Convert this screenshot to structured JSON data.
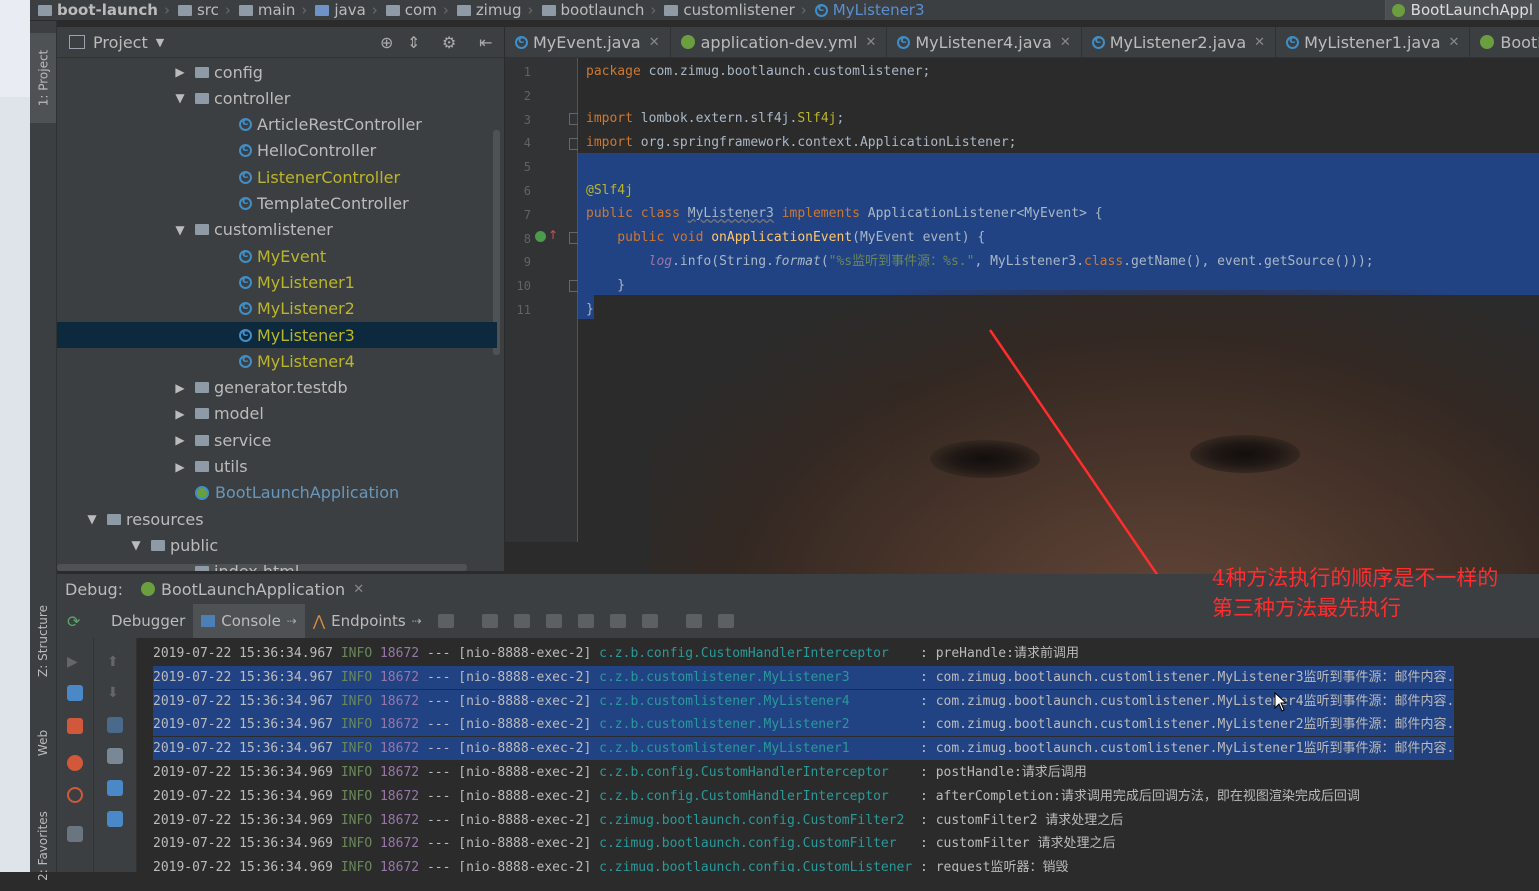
{
  "breadcrumb": {
    "items": [
      "boot-launch",
      "src",
      "main",
      "java",
      "com",
      "zimug",
      "bootlaunch",
      "customlistener",
      "MyListener3"
    ],
    "run_config": "BootLaunchAppl"
  },
  "sidebar": {
    "project_tab": "1: Project",
    "structure_tab": "Z: Structure",
    "web_tab": "Web",
    "favorites_tab": "2: Favorites"
  },
  "project": {
    "title": "Project",
    "tree": [
      {
        "label": "config",
        "type": "folder",
        "arrow": "▶",
        "indent": 0,
        "style": ""
      },
      {
        "label": "controller",
        "type": "folder",
        "arrow": "▼",
        "indent": 0,
        "style": ""
      },
      {
        "label": "ArticleRestController",
        "type": "class",
        "arrow": "",
        "indent": 1,
        "style": ""
      },
      {
        "label": "HelloController",
        "type": "class",
        "arrow": "",
        "indent": 1,
        "style": ""
      },
      {
        "label": "ListenerController",
        "type": "class",
        "arrow": "",
        "indent": 1,
        "style": "yellow"
      },
      {
        "label": "TemplateController",
        "type": "class",
        "arrow": "",
        "indent": 1,
        "style": ""
      },
      {
        "label": "customlistener",
        "type": "folder",
        "arrow": "▼",
        "indent": 0,
        "style": ""
      },
      {
        "label": "MyEvent",
        "type": "class",
        "arrow": "",
        "indent": 1,
        "style": "yellow"
      },
      {
        "label": "MyListener1",
        "type": "class",
        "arrow": "",
        "indent": 1,
        "style": "yellow"
      },
      {
        "label": "MyListener2",
        "type": "class",
        "arrow": "",
        "indent": 1,
        "style": "yellow"
      },
      {
        "label": "MyListener3",
        "type": "class",
        "arrow": "",
        "indent": 1,
        "style": "yellow",
        "selected": true
      },
      {
        "label": "MyListener4",
        "type": "class",
        "arrow": "",
        "indent": 1,
        "style": "yellow"
      },
      {
        "label": "generator.testdb",
        "type": "folder",
        "arrow": "▶",
        "indent": 0,
        "style": ""
      },
      {
        "label": "model",
        "type": "folder",
        "arrow": "▶",
        "indent": 0,
        "style": ""
      },
      {
        "label": "service",
        "type": "folder",
        "arrow": "▶",
        "indent": 0,
        "style": ""
      },
      {
        "label": "utils",
        "type": "folder",
        "arrow": "▶",
        "indent": 0,
        "style": ""
      },
      {
        "label": "BootLaunchApplication",
        "type": "spring",
        "arrow": "",
        "indent": 0,
        "style": "changed"
      },
      {
        "label": "resources",
        "type": "folder",
        "arrow": "▼",
        "indent": -2,
        "style": ""
      },
      {
        "label": "public",
        "type": "folder",
        "arrow": "▼",
        "indent": -1,
        "style": ""
      },
      {
        "label": "index.html",
        "type": "file",
        "arrow": "",
        "indent": 0,
        "style": ""
      }
    ]
  },
  "tabs": [
    {
      "label": "MyEvent.java",
      "icon": "class-icon"
    },
    {
      "label": "application-dev.yml",
      "icon": "spring-icon"
    },
    {
      "label": "MyListener4.java",
      "icon": "class-icon"
    },
    {
      "label": "MyListener2.java",
      "icon": "class-icon"
    },
    {
      "label": "MyListener1.java",
      "icon": "class-icon"
    },
    {
      "label": "BootLaunch",
      "icon": "spring-icon"
    }
  ],
  "editor": {
    "line_numbers": [
      "1",
      "2",
      "3",
      "4",
      "5",
      "6",
      "7",
      "8",
      "9",
      "10",
      "11"
    ],
    "code": {
      "l1_kw": "package",
      "l1_rest": " com.zimug.bootlaunch.customlistener;",
      "l3_kw": "import",
      "l3_rest": " lombok.extern.slf4j.",
      "l3_ann": "Slf4j",
      "l3_end": ";",
      "l4_kw": "import",
      "l4_rest": " org.springframework.context.ApplicationListener;",
      "l6_ann": "@Slf4j",
      "l7_kw1": "public class ",
      "l7_name": "MyListener3",
      "l7_kw2": " implements ",
      "l7_rest": "ApplicationListener<MyEvent> {",
      "l8_kw": "    public void ",
      "l8_fn": "onApplicationEvent",
      "l8_rest": "(MyEvent event) {",
      "l9_indent": "        ",
      "l9_log": "log",
      "l9_a": ".info(String.",
      "l9_fmt": "format",
      "l9_b": "(",
      "l9_str": "\"%s监听到事件源：%s.\"",
      "l9_c": ", MyListener3.",
      "l9_kw": "class",
      "l9_d": ".getName(), event.getSource()));",
      "l10": "    }",
      "l11": "}"
    }
  },
  "debug": {
    "label": "Debug:",
    "session": "BootLaunchApplication",
    "tabs": [
      "Debugger",
      "Console",
      "Endpoints"
    ]
  },
  "console": {
    "rows": [
      {
        "ts": "2019-07-22 15:36:34.967",
        "lvl": "INFO",
        "pid": "18672",
        "thread": " --- [nio-8888-exec-2] ",
        "logger": "c.z.b.config.CustomHandlerInterceptor   ",
        "msg": " : preHandle:请求前调用",
        "sel": false
      },
      {
        "ts": "2019-07-22 15:36:34.967",
        "lvl": "INFO",
        "pid": "18672",
        "thread": " --- [nio-8888-exec-2] ",
        "logger": "c.z.b.customlistener.MyListener3        ",
        "msg": " : com.zimug.bootlaunch.customlistener.MyListener3监听到事件源：邮件内容.",
        "sel": true
      },
      {
        "ts": "2019-07-22 15:36:34.967",
        "lvl": "INFO",
        "pid": "18672",
        "thread": " --- [nio-8888-exec-2] ",
        "logger": "c.z.b.customlistener.MyListener4        ",
        "msg": " : com.zimug.bootlaunch.customlistener.MyListener4监听到事件源：邮件内容.",
        "sel": true
      },
      {
        "ts": "2019-07-22 15:36:34.967",
        "lvl": "INFO",
        "pid": "18672",
        "thread": " --- [nio-8888-exec-2] ",
        "logger": "c.z.b.customlistener.MyListener2        ",
        "msg": " : com.zimug.bootlaunch.customlistener.MyListener2监听到事件源：邮件内容.",
        "sel": true
      },
      {
        "ts": "2019-07-22 15:36:34.967",
        "lvl": "INFO",
        "pid": "18672",
        "thread": " --- [nio-8888-exec-2] ",
        "logger": "c.z.b.customlistener.MyListener1        ",
        "msg": " : com.zimug.bootlaunch.customlistener.MyListener1监听到事件源：邮件内容.",
        "sel": true
      },
      {
        "ts": "2019-07-22 15:36:34.969",
        "lvl": "INFO",
        "pid": "18672",
        "thread": " --- [nio-8888-exec-2] ",
        "logger": "c.z.b.config.CustomHandlerInterceptor   ",
        "msg": " : postHandle:请求后调用",
        "sel": false
      },
      {
        "ts": "2019-07-22 15:36:34.969",
        "lvl": "INFO",
        "pid": "18672",
        "thread": " --- [nio-8888-exec-2] ",
        "logger": "c.z.b.config.CustomHandlerInterceptor   ",
        "msg": " : afterCompletion:请求调用完成后回调方法，即在视图渲染完成后回调",
        "sel": false
      },
      {
        "ts": "2019-07-22 15:36:34.969",
        "lvl": "INFO",
        "pid": "18672",
        "thread": " --- [nio-8888-exec-2] ",
        "logger": "c.zimug.bootlaunch.config.CustomFilter2 ",
        "msg": " : customFilter2 请求处理之后",
        "sel": false
      },
      {
        "ts": "2019-07-22 15:36:34.969",
        "lvl": "INFO",
        "pid": "18672",
        "thread": " --- [nio-8888-exec-2] ",
        "logger": "c.zimug.bootlaunch.config.CustomFilter  ",
        "msg": " : customFilter 请求处理之后",
        "sel": false
      },
      {
        "ts": "2019-07-22 15:36:34.969",
        "lvl": "INFO",
        "pid": "18672",
        "thread": " --- [nio-8888-exec-2] ",
        "logger": "c.zimug.bootlaunch.config.CustomListener",
        "msg": " : request监听器：销毁",
        "sel": false
      }
    ]
  },
  "annotation": {
    "line1": "4种方法执行的顺序是不一样的",
    "line2": "第三种方法最先执行",
    "color": "#ff2d2d"
  }
}
